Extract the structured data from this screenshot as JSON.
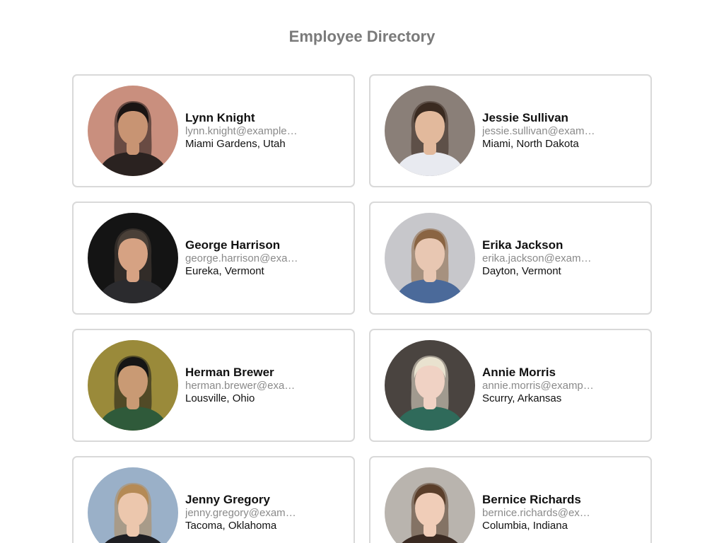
{
  "page": {
    "title": "Employee Directory"
  },
  "employees": [
    {
      "name": "Lynn Knight",
      "email": "lynn.knight@example.com",
      "location": "Miami Gardens, Utah",
      "avatar": {
        "bg": "#c98f7e",
        "skin": "#c89473",
        "hair": "#1a1413",
        "shirt": "#2a2220"
      }
    },
    {
      "name": "Jessie Sullivan",
      "email": "jessie.sullivan@example.com",
      "location": "Miami, North Dakota",
      "avatar": {
        "bg": "#8a7f78",
        "skin": "#e2b99c",
        "hair": "#3a2a20",
        "shirt": "#e8eaf0"
      }
    },
    {
      "name": "George Harrison",
      "email": "george.harrison@example.com",
      "location": "Eureka, Vermont",
      "avatar": {
        "bg": "#141414",
        "skin": "#d6a283",
        "hair": "#4a4038",
        "shirt": "#2b2b2e"
      }
    },
    {
      "name": "Erika Jackson",
      "email": "erika.jackson@example.com",
      "location": "Dayton, Vermont",
      "avatar": {
        "bg": "#c7c7cb",
        "skin": "#e8c7b2",
        "hair": "#8a6442",
        "shirt": "#4b6a9a"
      }
    },
    {
      "name": "Herman Brewer",
      "email": "herman.brewer@example.com",
      "location": "Lousville, Ohio",
      "avatar": {
        "bg": "#9a8a3a",
        "skin": "#c99a74",
        "hair": "#151515",
        "shirt": "#2f5a3a"
      }
    },
    {
      "name": "Annie Morris",
      "email": "annie.morris@example.com",
      "location": "Scurry, Arkansas",
      "avatar": {
        "bg": "#4a4440",
        "skin": "#f0d2c4",
        "hair": "#e9e2cf",
        "shirt": "#2f6a5a"
      }
    },
    {
      "name": "Jenny Gregory",
      "email": "jenny.gregory@example.com",
      "location": "Tacoma, Oklahoma",
      "avatar": {
        "bg": "#9ab0c8",
        "skin": "#ecc7ad",
        "hair": "#b58a55",
        "shirt": "#1e1e22"
      }
    },
    {
      "name": "Bernice Richards",
      "email": "bernice.richards@example.com",
      "location": "Columbia, Indiana",
      "avatar": {
        "bg": "#b9b4ae",
        "skin": "#f0cdb8",
        "hair": "#5a3e2a",
        "shirt": "#3a2a22"
      }
    }
  ]
}
